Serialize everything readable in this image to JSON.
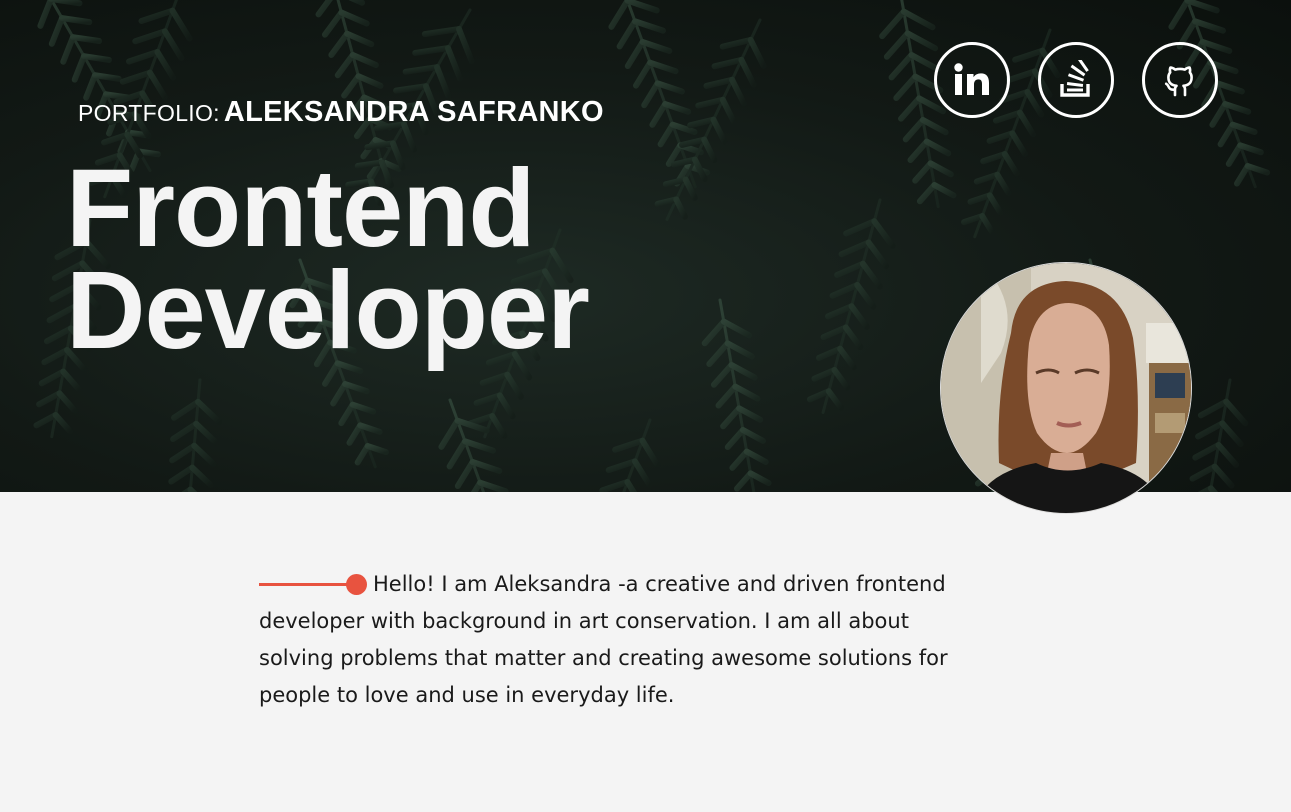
{
  "header": {
    "portfolio_prefix": "PORTFOLIO:",
    "portfolio_name": "ALEKSANDRA SAFRANKO",
    "title_line1": "Frontend",
    "title_line2": "Developer"
  },
  "social": [
    {
      "label": "in",
      "icon": "linkedin-icon"
    },
    {
      "icon": "stack-overflow-icon"
    },
    {
      "icon": "github-icon"
    }
  ],
  "intro": {
    "text": "Hello! I am Aleksandra -a creative and driven frontend developer with background in art conservation. I am all about solving problems that matter and creating awesome solutions for people to love and use in everyday life."
  },
  "colors": {
    "accent": "#e8533f",
    "hero_dark": "#121915",
    "page_background": "#f4f4f4",
    "text": "#1a1a1a"
  }
}
